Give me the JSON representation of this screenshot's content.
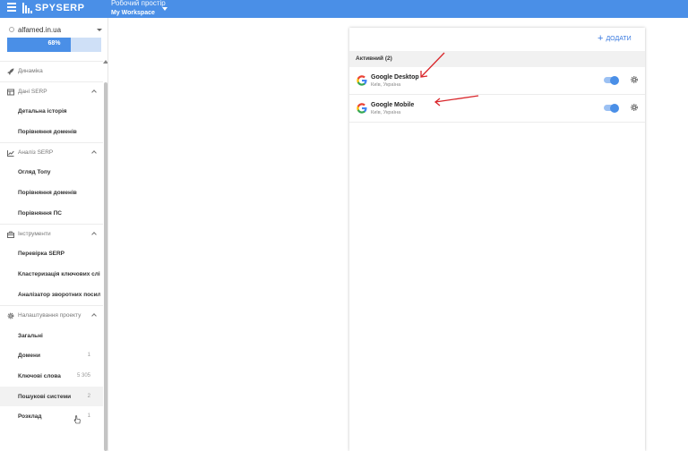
{
  "topbar": {
    "brand": "SPYSERP",
    "workspace_label": "Робочий простір",
    "workspace_name": "My Workspace"
  },
  "sidebar": {
    "site": "alfamed.in.ua",
    "progress_text": "68%",
    "progress_value": 0.68,
    "nav": [
      {
        "type": "section",
        "label": "Динаміка",
        "icon": "rocket-icon"
      },
      {
        "type": "section",
        "label": "Дані SERP",
        "icon": "table-icon"
      },
      {
        "type": "item",
        "label": "Детальна історія"
      },
      {
        "type": "item",
        "label": "Порівняння доменів"
      },
      {
        "type": "section",
        "label": "Аналіз SERP",
        "icon": "chart-icon"
      },
      {
        "type": "item",
        "label": "Огляд Топу"
      },
      {
        "type": "item",
        "label": "Порівняння доменів"
      },
      {
        "type": "item",
        "label": "Порівняння ПС"
      },
      {
        "type": "section",
        "label": "Інструменти",
        "icon": "toolbox-icon"
      },
      {
        "type": "item",
        "label": "Перевірка SERP"
      },
      {
        "type": "item",
        "label": "Кластеризація ключових слів"
      },
      {
        "type": "item",
        "label": "Аналізатор зворотних посилань"
      },
      {
        "type": "section",
        "label": "Налаштування проекту",
        "icon": "gear-icon"
      },
      {
        "type": "item",
        "label": "Загальні"
      },
      {
        "type": "item",
        "label": "Домени",
        "count": "1"
      },
      {
        "type": "item",
        "label": "Ключові слова",
        "count": "5 305"
      },
      {
        "type": "item",
        "label": "Пошукові системи",
        "count": "2"
      },
      {
        "type": "item",
        "label": "Розклад",
        "count": "1"
      }
    ]
  },
  "panel": {
    "add_label": "ДОДАТИ",
    "group_title": "Активний (2)",
    "engines": [
      {
        "name": "Google Desktop",
        "location": "Київ, Україна",
        "enabled": true
      },
      {
        "name": "Google Mobile",
        "location": "Київ, Україна",
        "enabled": true
      }
    ]
  },
  "colors": {
    "brand_blue": "#4a8fe7",
    "annotation_red": "#d9262b"
  }
}
